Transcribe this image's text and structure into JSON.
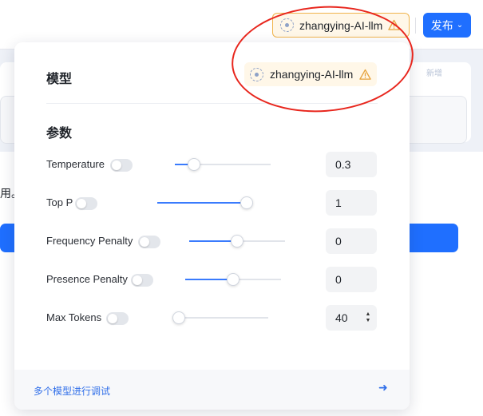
{
  "header": {
    "model_name": "zhangying-AI-llm",
    "publish_label": "发布",
    "publish_chevron": "⌄"
  },
  "background": {
    "partial_text": "用。",
    "tag_text": "新增"
  },
  "popover": {
    "model_section_title": "模型",
    "model_name": "zhangying-AI-llm",
    "params_section_title": "参数",
    "params": [
      {
        "label": "Temperature",
        "value": "0.3",
        "slider_fraction": 0.2,
        "enabled": false
      },
      {
        "label": "Top P",
        "value": "1",
        "slider_fraction": 1.0,
        "enabled": false
      },
      {
        "label": "Frequency Penalty",
        "value": "0",
        "slider_fraction": 0.5,
        "enabled": false
      },
      {
        "label": "Presence Penalty",
        "value": "0",
        "slider_fraction": 0.5,
        "enabled": false
      },
      {
        "label": "Max Tokens",
        "value": "40",
        "slider_fraction": 0.0,
        "enabled": false
      }
    ],
    "footer_link": "多个模型进行调试",
    "footer_arrow": "➜"
  },
  "colors": {
    "accent": "#1f6fff",
    "warning": "#f0b44c",
    "annotation": "#e8261d"
  }
}
